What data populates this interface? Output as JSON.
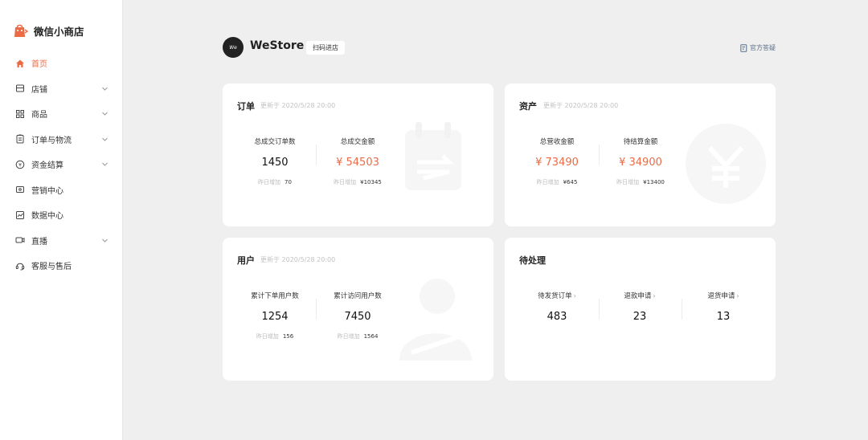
{
  "brand": {
    "title": "微信小商店",
    "color": "#ec6b45"
  },
  "sidebar": {
    "items": [
      {
        "label": "首页",
        "icon": "home-icon",
        "active": true,
        "expandable": false
      },
      {
        "label": "店铺",
        "icon": "store-icon",
        "active": false,
        "expandable": true
      },
      {
        "label": "商品",
        "icon": "grid-icon",
        "active": false,
        "expandable": true
      },
      {
        "label": "订单与物流",
        "icon": "clipboard-icon",
        "active": false,
        "expandable": true
      },
      {
        "label": "资金结算",
        "icon": "yen-circle-icon",
        "active": false,
        "expandable": true
      },
      {
        "label": "营销中心",
        "icon": "ticket-icon",
        "active": false,
        "expandable": false
      },
      {
        "label": "数据中心",
        "icon": "chart-icon",
        "active": false,
        "expandable": false
      },
      {
        "label": "直播",
        "icon": "video-icon",
        "active": false,
        "expandable": true
      },
      {
        "label": "客服与售后",
        "icon": "headset-icon",
        "active": false,
        "expandable": false
      }
    ]
  },
  "header": {
    "logo_text": "We",
    "title": "WeStore",
    "scan_label": "扫码进店",
    "help_label": "官方答疑"
  },
  "orders": {
    "title": "订单",
    "updated": "更新于 2020/5/28 20:00",
    "stats": [
      {
        "label": "总成交订单数",
        "value": "1450",
        "foot_key": "昨日增加",
        "foot_val": "70"
      },
      {
        "label": "总成交金额",
        "value": "¥ 54503",
        "foot_key": "昨日增加",
        "foot_val": "¥10345"
      }
    ]
  },
  "assets": {
    "title": "资产",
    "updated": "更新于 2020/5/28 20:00",
    "stats": [
      {
        "label": "总营收金额",
        "value": "¥ 73490",
        "foot_key": "昨日增加",
        "foot_val": "¥645"
      },
      {
        "label": "待结算金额",
        "value": "¥ 34900",
        "foot_key": "昨日增加",
        "foot_val": "¥13400"
      }
    ]
  },
  "users": {
    "title": "用户",
    "updated": "更新于 2020/5/28 20:00",
    "stats": [
      {
        "label": "累计下单用户数",
        "value": "1254",
        "foot_key": "昨日增加",
        "foot_val": "156"
      },
      {
        "label": "累计访问用户数",
        "value": "7450",
        "foot_key": "昨日增加",
        "foot_val": "1564"
      }
    ]
  },
  "pending": {
    "title": "待处理",
    "stats": [
      {
        "label": "待发货订单",
        "value": "483"
      },
      {
        "label": "退款申请",
        "value": "23"
      },
      {
        "label": "退货申请",
        "value": "13"
      }
    ]
  }
}
